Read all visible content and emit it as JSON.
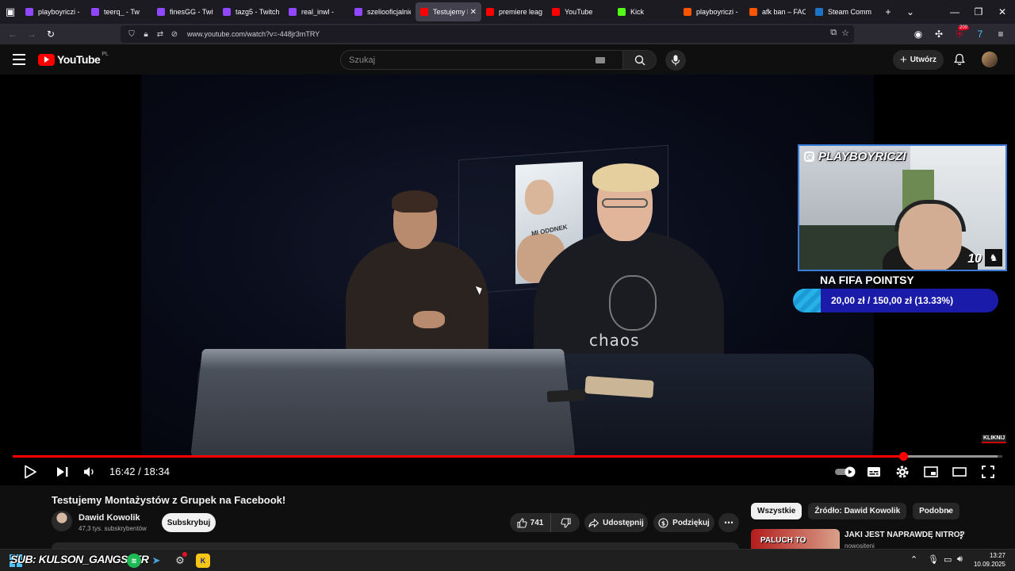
{
  "browser": {
    "tabs": [
      {
        "label": "playboyriczi - T",
        "favicon": "twitch-icon",
        "color": "#9146ff",
        "active": false
      },
      {
        "label": "teerq_ - Tw",
        "favicon": "twitch-icon",
        "color": "#9146ff",
        "active": false
      },
      {
        "label": "finesGG - Twitc",
        "favicon": "twitch-icon",
        "color": "#9146ff",
        "active": false
      },
      {
        "label": "tazg5 - Twitch",
        "favicon": "twitch-icon",
        "color": "#9146ff",
        "active": false
      },
      {
        "label": "real_inwl -",
        "favicon": "twitch-icon",
        "color": "#9146ff",
        "active": false
      },
      {
        "label": "szeliooficjalnie -",
        "favicon": "twitch-icon",
        "color": "#9146ff",
        "active": false
      },
      {
        "label": "Testujemy M",
        "favicon": "youtube-icon",
        "color": "#ff0000",
        "active": true
      },
      {
        "label": "premiere league",
        "favicon": "youtube-icon",
        "color": "#ff0000",
        "active": false
      },
      {
        "label": "YouTube",
        "favicon": "youtube-icon",
        "color": "#ff0000",
        "active": false
      },
      {
        "label": "Kick",
        "favicon": "kick-icon",
        "color": "#53fc18",
        "active": false
      },
      {
        "label": "playboyriczi - F",
        "favicon": "faceit-icon",
        "color": "#ff5500",
        "active": false
      },
      {
        "label": "afk ban – FACEI",
        "favicon": "faceit-icon",
        "color": "#ff5500",
        "active": false
      },
      {
        "label": "Steam Commu",
        "favicon": "steam-icon",
        "color": "#1b74c5",
        "active": false
      }
    ],
    "url": "www.youtube.com/watch?v=-448jr3mTRY",
    "extension_badge": "200"
  },
  "youtube": {
    "logo_text": "YouTube",
    "country_code": "PL",
    "search_placeholder": "Szukaj",
    "create_label": "Utwórz"
  },
  "player": {
    "current_time": "16:42",
    "duration": "18:34",
    "time_separator": "/",
    "played_fraction": 0.9,
    "loaded_fraction": 0.995,
    "overlay": {
      "streamer_handle": "PLAYBOYRICZI",
      "goal_title": "NA FIFA POINTSY",
      "goal_text": "20,00 zł  /  150,00 zł (13.33%)",
      "goal_fraction": 0.1333,
      "corner_number": "10",
      "kliknij": "KLIKNIJ",
      "shirt_text": "chaos",
      "poster_text": "MI ODDNEK"
    }
  },
  "video": {
    "title": "Testujemy Montażystów z Grupek na Facebook!",
    "channel": "Dawid Kowolik",
    "subscribers": "47,3 tys. subskrybentów",
    "subscribe_label": "Subskrybuj",
    "likes": "741",
    "share_label": "Udostępnij",
    "thanks_label": "Podziękuj"
  },
  "sidebar": {
    "chips": [
      "Wszystkie",
      "Źródło: Dawid Kowolik",
      "Podobne"
    ],
    "recommendation": {
      "thumb_text": "PALUCH TO",
      "title": "JAKI JEST NAPRAWDĘ NITRO?",
      "meta": "nowositeni"
    }
  },
  "taskbar": {
    "label": "SUB: KULSON_GANGSTER",
    "time": "13:27",
    "date": "10.09.2025"
  }
}
